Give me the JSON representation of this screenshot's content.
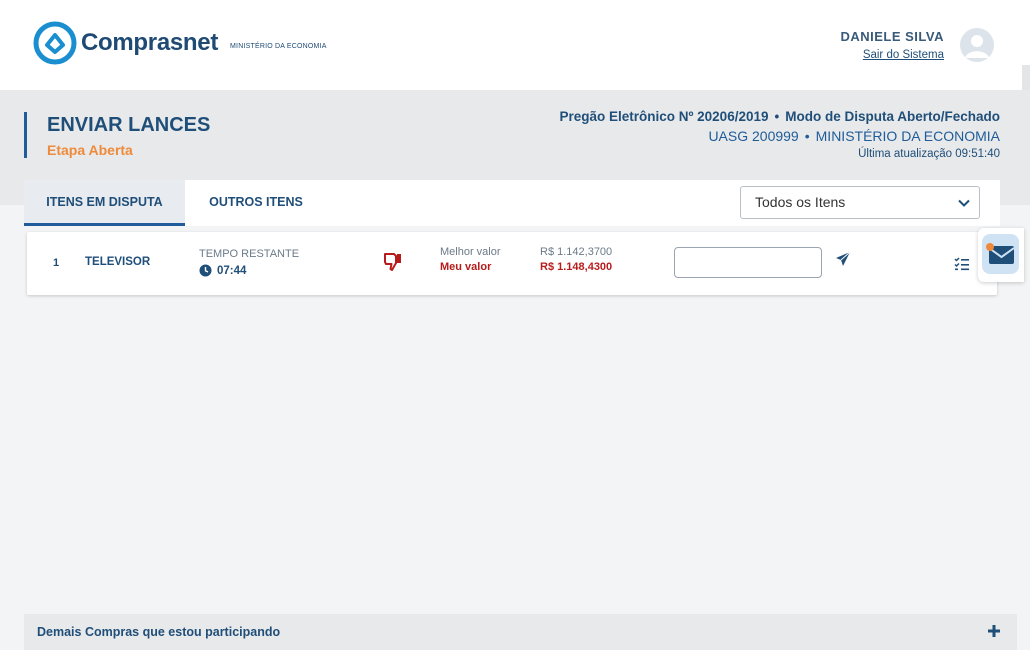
{
  "header": {
    "brand": "Comprasnet",
    "brand_sub": "MINISTÉRIO DA ECONOMIA",
    "user_name": "DANIELE SILVA",
    "logout_label": "Sair do Sistema"
  },
  "page": {
    "title": "ENVIAR LANCES",
    "subtitle": "Etapa Aberta",
    "pregao": "Pregão Eletrônico Nº 20206/2019",
    "modo": "Modo de Disputa Aberto/Fechado",
    "uasg": "UASG 200999",
    "orgao": "MINISTÉRIO DA ECONOMIA",
    "last_update": "Última atualização 09:51:40",
    "separator": "•"
  },
  "tabs": [
    {
      "label": "ITENS EM DISPUTA",
      "active": true
    },
    {
      "label": "OUTROS ITENS",
      "active": false
    }
  ],
  "filter": {
    "selected": "Todos os Itens"
  },
  "items": [
    {
      "number": "1",
      "name": "TELEVISOR",
      "time_label": "TEMPO RESTANTE",
      "time_value": "07:44",
      "best_label": "Melhor valor",
      "best_value": "R$ 1.142,3700",
      "mine_label": "Meu valor",
      "mine_value": "R$ 1.148,4300",
      "bid_value": "",
      "status_icon": "thumbs-down-icon"
    }
  ],
  "footer": {
    "other_purchases_label": "Demais Compras que estou participando"
  },
  "colors": {
    "primary": "#1f4e79",
    "accent": "#ef8a3a",
    "danger": "#b71c1c",
    "band": "#e8e9ea"
  }
}
